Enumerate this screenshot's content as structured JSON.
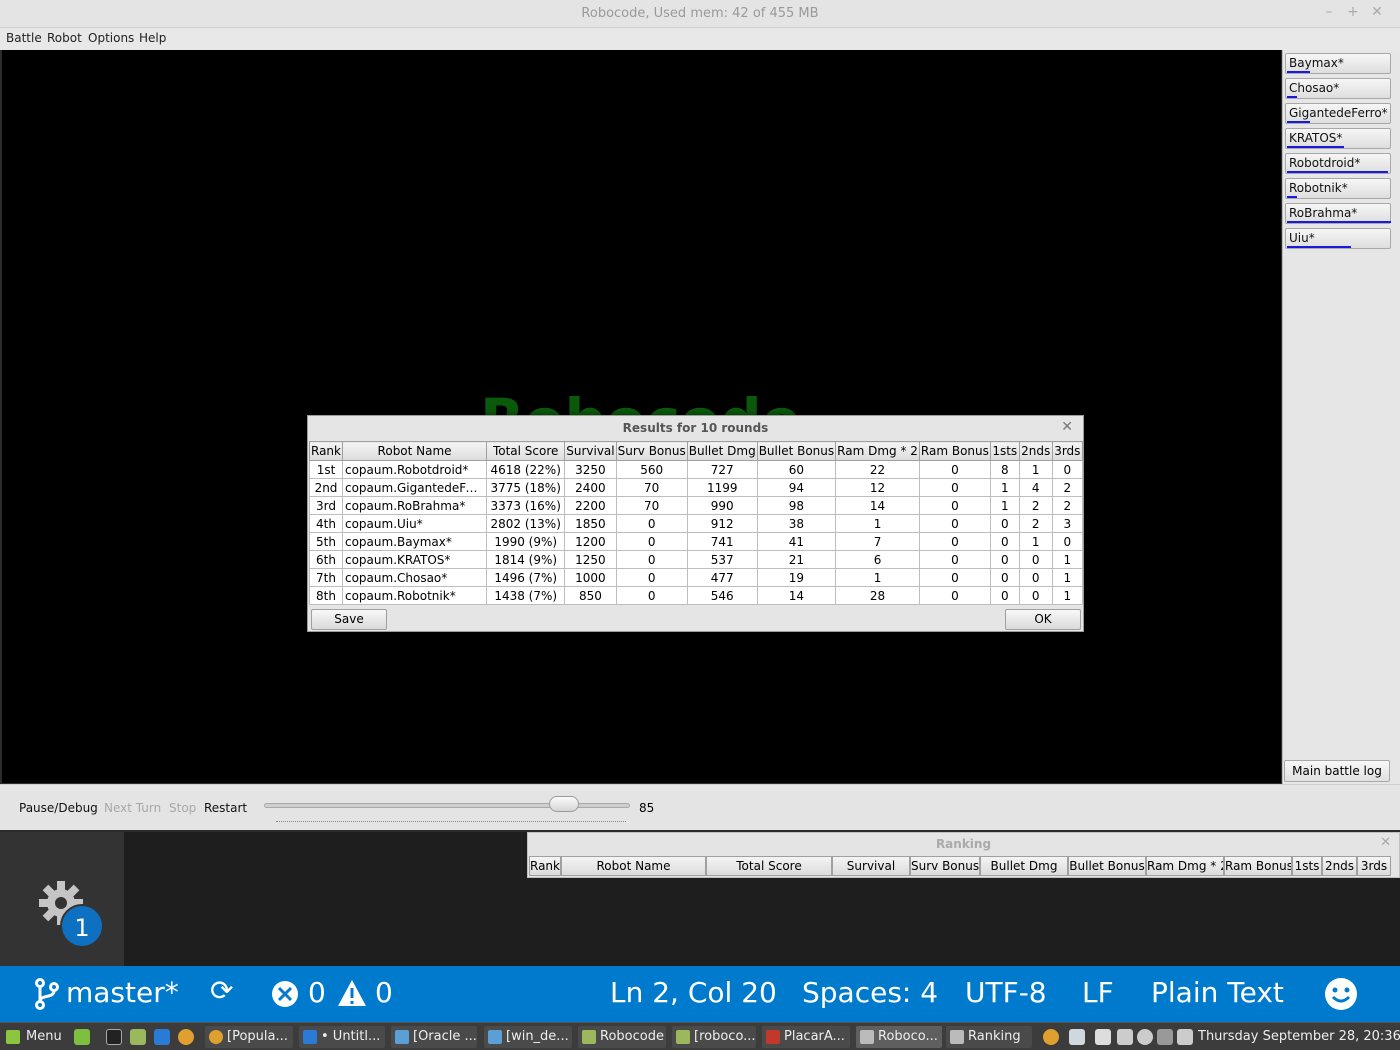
{
  "window": {
    "title": "Robocode, Used mem: 42 of 455 MB",
    "controls": [
      "–",
      "+",
      "✕"
    ]
  },
  "menu": [
    "Battle",
    "Robot",
    "Options",
    "Help"
  ],
  "watermark": "Robocode",
  "robots": [
    {
      "label": "Baymax*",
      "health": 0.22
    },
    {
      "label": "Chosao*",
      "health": 0.1
    },
    {
      "label": "GigantedeFerro*",
      "health": 0.22
    },
    {
      "label": "KRATOS*",
      "health": 0.55
    },
    {
      "label": "Robotdroid*",
      "health": 0.97
    },
    {
      "label": "Robotnik*",
      "health": 0.1
    },
    {
      "label": "RoBrahma*",
      "health": 1.0
    },
    {
      "label": "Uiu*",
      "health": 0.62
    }
  ],
  "main_battle_log": "Main battle log",
  "controls": {
    "pause": "Pause/Debug",
    "next_turn": "Next Turn",
    "stop": "Stop",
    "restart": "Restart",
    "speed": "85",
    "speed_fraction": 0.82
  },
  "results_dialog": {
    "title": "Results for 10 rounds",
    "headers": [
      "Rank",
      "Robot Name",
      "Total Score",
      "Survival",
      "Surv Bonus",
      "Bullet Dmg",
      "Bullet Bonus",
      "Ram Dmg * 2",
      "Ram Bonus",
      "1sts",
      "2nds",
      "3rds"
    ],
    "rows": [
      [
        "1st",
        "copaum.Robotdroid*",
        "4618 (22%)",
        "3250",
        "560",
        "727",
        "60",
        "22",
        "0",
        "8",
        "1",
        "0"
      ],
      [
        "2nd",
        "copaum.GigantedeFerr...",
        "3775 (18%)",
        "2400",
        "70",
        "1199",
        "94",
        "12",
        "0",
        "1",
        "4",
        "2"
      ],
      [
        "3rd",
        "copaum.RoBrahma*",
        "3373 (16%)",
        "2200",
        "70",
        "990",
        "98",
        "14",
        "0",
        "1",
        "2",
        "2"
      ],
      [
        "4th",
        "copaum.Uiu*",
        "2802 (13%)",
        "1850",
        "0",
        "912",
        "38",
        "1",
        "0",
        "0",
        "2",
        "3"
      ],
      [
        "5th",
        "copaum.Baymax*",
        "1990 (9%)",
        "1200",
        "0",
        "741",
        "41",
        "7",
        "0",
        "0",
        "1",
        "0"
      ],
      [
        "6th",
        "copaum.KRATOS*",
        "1814 (9%)",
        "1250",
        "0",
        "537",
        "21",
        "6",
        "0",
        "0",
        "0",
        "1"
      ],
      [
        "7th",
        "copaum.Chosao*",
        "1496 (7%)",
        "1000",
        "0",
        "477",
        "19",
        "1",
        "0",
        "0",
        "0",
        "1"
      ],
      [
        "8th",
        "copaum.Robotnik*",
        "1438 (7%)",
        "850",
        "0",
        "546",
        "14",
        "28",
        "0",
        "0",
        "0",
        "1"
      ]
    ],
    "save": "Save",
    "ok": "OK"
  },
  "ranking_panel": {
    "title": "Ranking",
    "headers": [
      "Rank",
      "Robot Name",
      "Total Score",
      "Survival",
      "Surv Bonus",
      "Bullet Dmg",
      "Bullet Bonus",
      "Ram Dmg * 2",
      "Ram Bonus",
      "1sts",
      "2nds",
      "3rds"
    ]
  },
  "vscode": {
    "badge": "1",
    "branch": "master*",
    "errors": "0",
    "warnings": "0",
    "position": "Ln 2, Col 20",
    "spaces": "Spaces: 4",
    "encoding": "UTF-8",
    "eol": "LF",
    "language": "Plain Text",
    "accent": "#007acc"
  },
  "taskbar": {
    "menu": "Menu",
    "items": [
      "[Popula...",
      "• Untitl...",
      "[Oracle ...",
      "[win_de...",
      "Robocode",
      "[roboco...",
      "PlacarA...",
      "Roboco...",
      "Ranking"
    ],
    "clock": "Thursday September 28, 20:36"
  }
}
